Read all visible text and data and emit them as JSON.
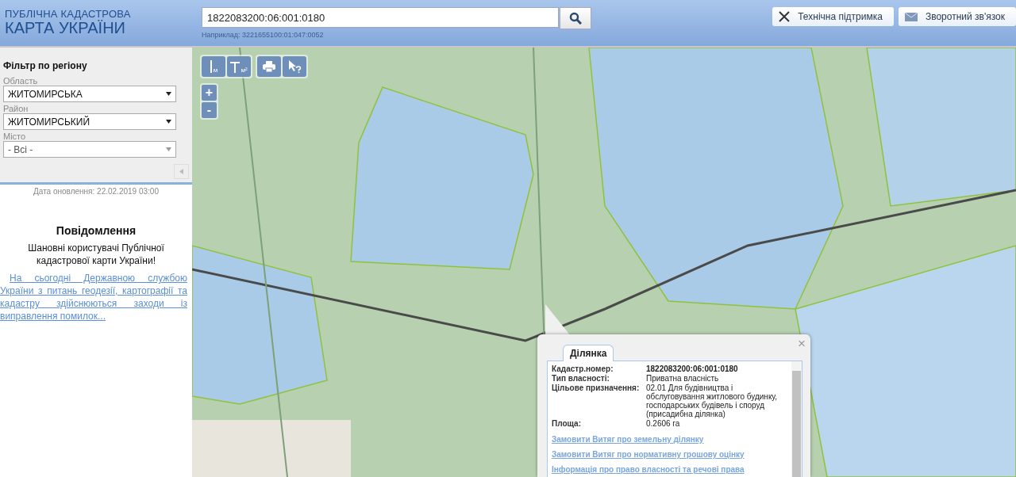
{
  "header": {
    "logo_top": "ПУБЛІЧНА КАДАСТРОВА",
    "logo_bottom": "КАРТА УКРАЇНИ",
    "search": {
      "value": "1822083200:06:001:0180",
      "hint": "Наприклад: 3221655100:01:047:0052"
    },
    "buttons": [
      {
        "kind": "support",
        "label": "Технічна підтримка"
      },
      {
        "kind": "feedback",
        "label": "Зворотний зв'язок"
      }
    ]
  },
  "sidebar": {
    "title": "Фільтр по регіону",
    "filters": [
      {
        "label": "Область",
        "value": "ЖИТОМИРСЬКА",
        "disabled": false
      },
      {
        "label": "Район",
        "value": "ЖИТОМИРСЬКИЙ",
        "disabled": false
      },
      {
        "label": "Місто",
        "value": "- Всі -",
        "disabled": true
      }
    ],
    "update_date": "Дата оновлення: 22.02.2019 03:00",
    "notice": {
      "title": "Повідомлення",
      "subtitle": "Шановні користувачі Публічної кадастрової карти України!",
      "link": "На сьогодні Державною службою України з питань геодезії, картографії та кадастру здійснюються заходи із виправлення помилок..."
    }
  },
  "map": {
    "tools": [
      {
        "kind": "distance",
        "unit": "м"
      },
      {
        "kind": "area",
        "unit": "м²"
      },
      {
        "kind": "print"
      },
      {
        "kind": "info"
      }
    ],
    "zoom": [
      "+",
      "-"
    ],
    "popup": {
      "tab": "Ділянка",
      "close": "×",
      "fields": [
        {
          "label": "Кадастр.номер:",
          "value": "1822083200:06:001:0180",
          "bold": true
        },
        {
          "label": "Тип власності:",
          "value": "Приватна власність",
          "bold": false
        },
        {
          "label": "Цільове призначення:",
          "value": "02.01 Для будівництва і обслуговування житлового будинку, господарських будівель і споруд (присадибна ділянка)",
          "bold": false
        },
        {
          "label": "Площа:",
          "value": "0.2606 га",
          "bold": false
        }
      ],
      "links": [
        "Замовити Витяг про земельну ділянку",
        "Замовити Витяг про нормативну грошову оцінку",
        "Інформація про право власності та речові права"
      ]
    }
  }
}
